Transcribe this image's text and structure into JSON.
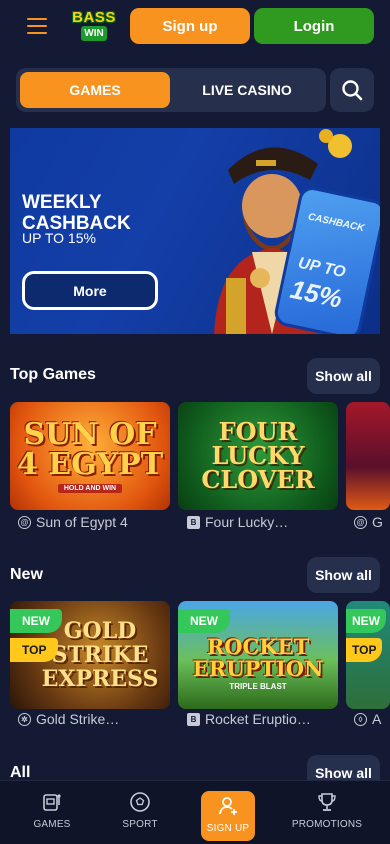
{
  "header": {
    "logo_line1": "BASS",
    "logo_line2": "WIN",
    "signup_label": "Sign up",
    "login_label": "Login"
  },
  "tabs": [
    {
      "label": "GAMES",
      "active": true
    },
    {
      "label": "LIVE CASINO",
      "active": false
    }
  ],
  "banner": {
    "title": "WEEKLY\nCASHBACK",
    "subtitle": "UP TO 15%",
    "button_label": "More",
    "phone_label": "CASHBACK",
    "phone_upto": "UP TO",
    "phone_pct": "15%"
  },
  "sections": {
    "top_games": {
      "title": "Top Games",
      "show_all": "Show all",
      "cards": [
        {
          "art": "SUN OF 4 EGYPT",
          "art_sub": "HOLD AND WIN",
          "caption": "Sun of Egypt 4",
          "provider_icon": "spiral-provider-icon"
        },
        {
          "art": "FOUR LUCKY CLOVER",
          "caption": "Four Lucky…",
          "provider_icon": "b-provider-icon"
        },
        {
          "caption": "G",
          "provider_icon": "spiral-provider-icon"
        }
      ]
    },
    "new": {
      "title": "New",
      "show_all": "Show all",
      "cards": [
        {
          "art": "GOLD STRIKE EXPRESS",
          "caption": "Gold Strike…",
          "badges": [
            "NEW",
            "TOP"
          ],
          "provider_icon": "gear-provider-icon"
        },
        {
          "art": "ROCKET ERUPTION",
          "art_sub": "TRIPLE BLAST",
          "caption": "Rocket Eruptio…",
          "badges": [
            "NEW"
          ],
          "provider_icon": "b-provider-icon"
        },
        {
          "caption": "A",
          "badges": [
            "NEW",
            "TOP"
          ],
          "provider_icon": "a-provider-icon"
        }
      ]
    },
    "all": {
      "title": "All",
      "show_all": "Show all"
    }
  },
  "bottom_nav": [
    {
      "label": "GAMES",
      "icon": "slot-machine-icon"
    },
    {
      "label": "SPORT",
      "icon": "soccer-ball-icon"
    },
    {
      "label": "SIGN UP",
      "icon": "add-user-icon",
      "active": true
    },
    {
      "label": "PROMOTIONS",
      "icon": "trophy-icon"
    }
  ],
  "colors": {
    "background": "#141a33",
    "accent_orange": "#f7931e",
    "login_green": "#2f9a1f",
    "panel": "#26304d",
    "new_badge": "#34c759",
    "top_badge": "#ffc81a"
  }
}
